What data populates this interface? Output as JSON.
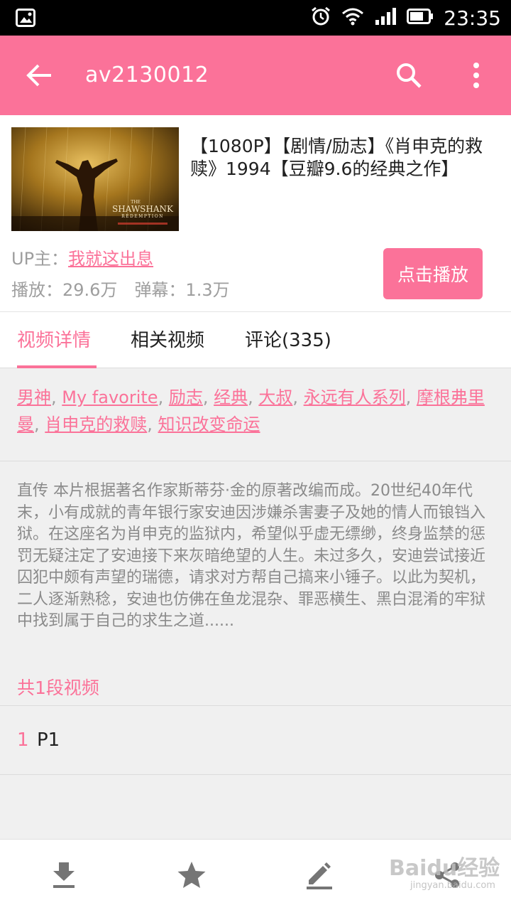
{
  "status_bar": {
    "time": "23:35"
  },
  "app_bar": {
    "title": "av2130012"
  },
  "video": {
    "poster_text": {
      "the": "THE",
      "name": "SHAWSHANK",
      "sub": "REDEMPTION"
    },
    "title": "【1080P】【剧情/励志】《肖申克的救赎》1994【豆瓣9.6的经典之作】",
    "uploader_label": "UP主：",
    "uploader_name": "我就这出息",
    "plays": "播放：29.6万",
    "danmaku": "弹幕：1.3万",
    "play_button": "点击播放"
  },
  "tabs": [
    {
      "label": "视频详情",
      "active": true
    },
    {
      "label": "相关视频",
      "active": false
    },
    {
      "label": "评论(335)",
      "active": false
    }
  ],
  "tags": [
    "男神",
    "My favorite",
    "励志",
    "经典",
    "大叔",
    "永远有人系列",
    "摩根弗里曼",
    "肖申克的救赎",
    "知识改变命运"
  ],
  "tag_separator": ", ",
  "description": "直传 本片根据著名作家斯蒂芬·金的原著改编而成。20世纪40年代末，小有成就的青年银行家安迪因涉嫌杀害妻子及她的情人而锒铛入狱。在这座名为肖申克的监狱内，希望似乎虚无缥缈，终身监禁的惩罚无疑注定了安迪接下来灰暗绝望的人生。未过多久，安迪尝试接近囚犯中颇有声望的瑞德，请求对方帮自己搞来小锤子。以此为契机，二人逐渐熟稔，安迪也仿佛在鱼龙混杂、罪恶横生、黑白混淆的牢狱中找到属于自己的求生之道......",
  "parts_count": "共1段视频",
  "parts": [
    {
      "index": "1",
      "name": "P1"
    }
  ],
  "watermark": {
    "main": "Baidu经验",
    "sub": "jingyan.baidu.com"
  },
  "colors": {
    "accent": "#fb7299",
    "status_bar": "#000000",
    "text_primary": "#212121",
    "text_secondary": "#9e9e9e"
  },
  "bottom_bar": [
    "download-icon",
    "star-icon",
    "edit-icon",
    "share-icon"
  ]
}
